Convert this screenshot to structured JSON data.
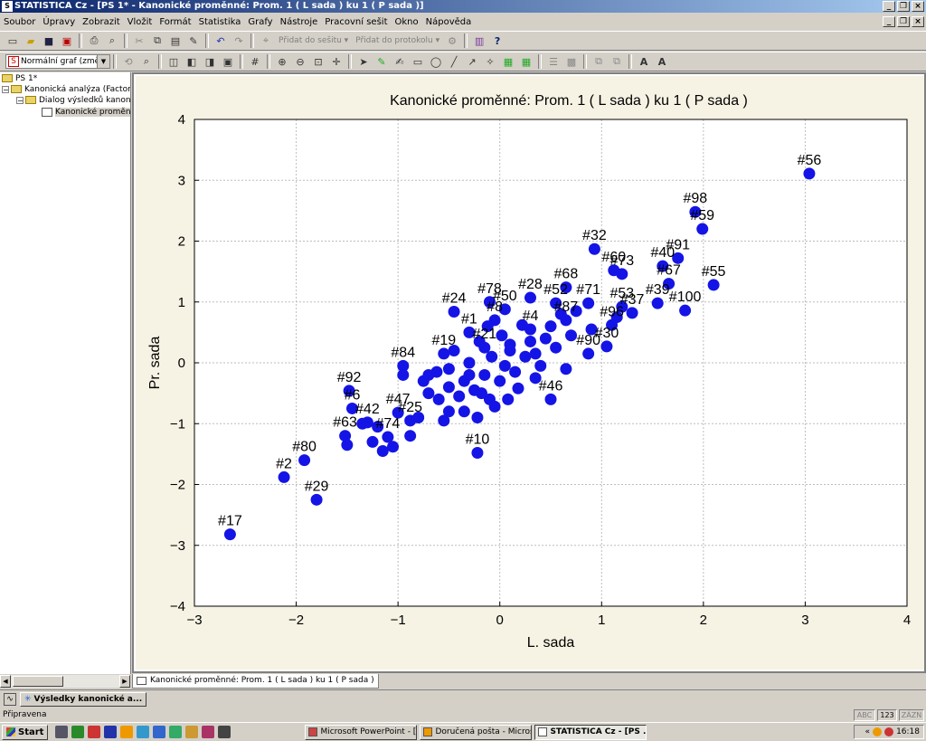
{
  "app": {
    "title": "STATISTICA Cz - [PS 1* - Kanonické proměnné: Prom.   1 ( L sada ) ku   1 ( P sada )]",
    "icon_label": "S"
  },
  "menu": [
    "Soubor",
    "Úpravy",
    "Zobrazit",
    "Vložit",
    "Formát",
    "Statistika",
    "Grafy",
    "Nástroje",
    "Pracovní sešit",
    "Okno",
    "Nápověda"
  ],
  "toolbar": {
    "add_to_workbook": "Přidat do sešitu ▾",
    "add_to_protocol": "Přidat do protokolu ▾",
    "graph_type": "Normální graf (změ..."
  },
  "tree": {
    "nodes": [
      {
        "label": "PS 1*",
        "level": 0
      },
      {
        "label": "Kanonická analýza (Factor.st",
        "level": 1
      },
      {
        "label": "Dialog výsledků kanonick",
        "level": 2
      },
      {
        "label": "Kanonické proměnné",
        "level": 3
      }
    ]
  },
  "doc_tab": "Kanonické proměnné: Prom.   1 ( L sada ) ku   1 ( P sada )",
  "results_window": "Výsledky kanonické a...",
  "status": {
    "text": "Připravena",
    "cells": [
      "ABC",
      "123",
      "ZÁZN"
    ]
  },
  "taskbar": {
    "start": "Start",
    "tasks": [
      "Microsoft PowerPoint - [...",
      "Doručená pošta - Micros...",
      "STATISTICA Cz - [PS ..."
    ],
    "clock": "16:18"
  },
  "chart_data": {
    "type": "scatter",
    "title": "Kanonické proměnné: Prom.   1 ( L sada ) ku   1 ( P sada )",
    "xlabel": "L. sada",
    "ylabel": "Pr. sada",
    "xlim": [
      -3,
      4
    ],
    "ylim": [
      -4,
      4
    ],
    "xticks": [
      -3,
      -2,
      -1,
      0,
      1,
      2,
      3,
      4
    ],
    "yticks": [
      4,
      3,
      2,
      1,
      0,
      -1,
      -2,
      -3,
      -4
    ],
    "grid": true,
    "point_color": "#1414e6",
    "points": [
      {
        "label": "#56",
        "x": 3.04,
        "y": 3.11
      },
      {
        "label": "#98",
        "x": 1.92,
        "y": 2.48
      },
      {
        "label": "#59",
        "x": 1.99,
        "y": 2.2
      },
      {
        "label": "#32",
        "x": 0.93,
        "y": 1.87
      },
      {
        "label": "#60",
        "x": 1.12,
        "y": 1.52
      },
      {
        "label": "#73",
        "x": 1.2,
        "y": 1.46
      },
      {
        "label": "#91",
        "x": 1.75,
        "y": 1.72
      },
      {
        "label": "#40",
        "x": 1.6,
        "y": 1.59
      },
      {
        "label": "#67",
        "x": 1.66,
        "y": 1.3
      },
      {
        "label": "#55",
        "x": 2.1,
        "y": 1.28
      },
      {
        "label": "#100",
        "x": 1.82,
        "y": 0.86
      },
      {
        "label": "#39",
        "x": 1.55,
        "y": 0.98
      },
      {
        "label": "#53",
        "x": 1.2,
        "y": 0.92
      },
      {
        "label": "#37",
        "x": 1.3,
        "y": 0.82
      },
      {
        "label": "#96",
        "x": 1.1,
        "y": 0.62
      },
      {
        "label": "#90",
        "x": 0.87,
        "y": 0.15
      },
      {
        "label": "#30",
        "x": 1.05,
        "y": 0.27
      },
      {
        "label": "#28",
        "x": 0.3,
        "y": 1.07
      },
      {
        "label": "#68",
        "x": 0.65,
        "y": 1.24
      },
      {
        "label": "#52",
        "x": 0.55,
        "y": 0.98
      },
      {
        "label": "#71",
        "x": 0.87,
        "y": 0.98
      },
      {
        "label": "#78",
        "x": -0.1,
        "y": 1.0
      },
      {
        "label": "#24",
        "x": -0.45,
        "y": 0.84
      },
      {
        "label": "#50",
        "x": 0.05,
        "y": 0.88
      },
      {
        "label": "#8",
        "x": -0.05,
        "y": 0.7
      },
      {
        "label": "#4",
        "x": 0.3,
        "y": 0.55
      },
      {
        "label": "#87",
        "x": 0.65,
        "y": 0.7
      },
      {
        "label": "#1",
        "x": -0.3,
        "y": 0.5
      },
      {
        "label": "#19",
        "x": -0.55,
        "y": 0.15
      },
      {
        "label": "#21",
        "x": -0.15,
        "y": 0.25
      },
      {
        "label": "#84",
        "x": -0.95,
        "y": -0.05
      },
      {
        "label": "#46",
        "x": 0.5,
        "y": -0.6
      },
      {
        "label": "#47",
        "x": -1.0,
        "y": -0.82
      },
      {
        "label": "#92",
        "x": -1.48,
        "y": -0.46
      },
      {
        "label": "#6",
        "x": -1.45,
        "y": -0.75
      },
      {
        "label": "#42",
        "x": -1.3,
        "y": -0.98
      },
      {
        "label": "#63",
        "x": -1.52,
        "y": -1.2
      },
      {
        "label": "#74",
        "x": -1.1,
        "y": -1.22
      },
      {
        "label": "#25",
        "x": -0.88,
        "y": -0.95
      },
      {
        "label": "#10",
        "x": -0.22,
        "y": -1.48
      },
      {
        "label": "#80",
        "x": -1.92,
        "y": -1.6
      },
      {
        "label": "#2",
        "x": -2.12,
        "y": -1.88
      },
      {
        "label": "#29",
        "x": -1.8,
        "y": -2.25
      },
      {
        "label": "#17",
        "x": -2.65,
        "y": -2.82
      },
      {
        "label": "",
        "x": -1.5,
        "y": -1.35
      },
      {
        "label": "",
        "x": -1.15,
        "y": -1.45
      },
      {
        "label": "",
        "x": -1.05,
        "y": -1.38
      },
      {
        "label": "",
        "x": -0.88,
        "y": -1.2
      },
      {
        "label": "",
        "x": -1.2,
        "y": -1.05
      },
      {
        "label": "",
        "x": -0.95,
        "y": -0.2
      },
      {
        "label": "",
        "x": -0.75,
        "y": -0.3
      },
      {
        "label": "",
        "x": -0.7,
        "y": -0.5
      },
      {
        "label": "",
        "x": -0.6,
        "y": -0.6
      },
      {
        "label": "",
        "x": -0.5,
        "y": -0.4
      },
      {
        "label": "",
        "x": -0.5,
        "y": -0.8
      },
      {
        "label": "",
        "x": -0.5,
        "y": -0.1
      },
      {
        "label": "",
        "x": -0.4,
        "y": -0.55
      },
      {
        "label": "",
        "x": -0.35,
        "y": -0.3
      },
      {
        "label": "",
        "x": -0.35,
        "y": -0.8
      },
      {
        "label": "",
        "x": -0.3,
        "y": 0.0
      },
      {
        "label": "",
        "x": -0.25,
        "y": -0.45
      },
      {
        "label": "",
        "x": -0.22,
        "y": -0.9
      },
      {
        "label": "",
        "x": -0.2,
        "y": 0.35
      },
      {
        "label": "",
        "x": -0.15,
        "y": -0.2
      },
      {
        "label": "",
        "x": -0.1,
        "y": -0.6
      },
      {
        "label": "",
        "x": -0.08,
        "y": 0.1
      },
      {
        "label": "",
        "x": -0.05,
        "y": -0.72
      },
      {
        "label": "",
        "x": 0.0,
        "y": -0.3
      },
      {
        "label": "",
        "x": 0.02,
        "y": 0.45
      },
      {
        "label": "",
        "x": 0.05,
        "y": -0.05
      },
      {
        "label": "",
        "x": 0.1,
        "y": 0.2
      },
      {
        "label": "",
        "x": 0.15,
        "y": -0.15
      },
      {
        "label": "",
        "x": 0.18,
        "y": -0.42
      },
      {
        "label": "",
        "x": 0.25,
        "y": 0.1
      },
      {
        "label": "",
        "x": 0.3,
        "y": 0.35
      },
      {
        "label": "",
        "x": 0.35,
        "y": 0.15
      },
      {
        "label": "",
        "x": 0.4,
        "y": -0.05
      },
      {
        "label": "",
        "x": 0.45,
        "y": 0.4
      },
      {
        "label": "",
        "x": 0.5,
        "y": 0.6
      },
      {
        "label": "",
        "x": 0.55,
        "y": 0.25
      },
      {
        "label": "",
        "x": 0.6,
        "y": 0.8
      },
      {
        "label": "",
        "x": 0.7,
        "y": 0.45
      },
      {
        "label": "",
        "x": 0.75,
        "y": 0.85
      },
      {
        "label": "",
        "x": 0.9,
        "y": 0.55
      },
      {
        "label": "",
        "x": 1.15,
        "y": 0.75
      },
      {
        "label": "",
        "x": -0.8,
        "y": -0.9
      },
      {
        "label": "",
        "x": -0.62,
        "y": -0.15
      },
      {
        "label": "",
        "x": -0.45,
        "y": 0.2
      },
      {
        "label": "",
        "x": -0.12,
        "y": 0.6
      },
      {
        "label": "",
        "x": 0.22,
        "y": 0.62
      },
      {
        "label": "",
        "x": -1.35,
        "y": -1.0
      },
      {
        "label": "",
        "x": -0.3,
        "y": -0.2
      },
      {
        "label": "",
        "x": 0.08,
        "y": -0.6
      },
      {
        "label": "",
        "x": -0.55,
        "y": -0.95
      },
      {
        "label": "",
        "x": 0.35,
        "y": -0.25
      },
      {
        "label": "",
        "x": -0.7,
        "y": -0.2
      },
      {
        "label": "",
        "x": 0.65,
        "y": -0.1
      },
      {
        "label": "",
        "x": -0.18,
        "y": -0.5
      },
      {
        "label": "",
        "x": 0.1,
        "y": 0.3
      },
      {
        "label": "",
        "x": -1.25,
        "y": -1.3
      }
    ]
  }
}
